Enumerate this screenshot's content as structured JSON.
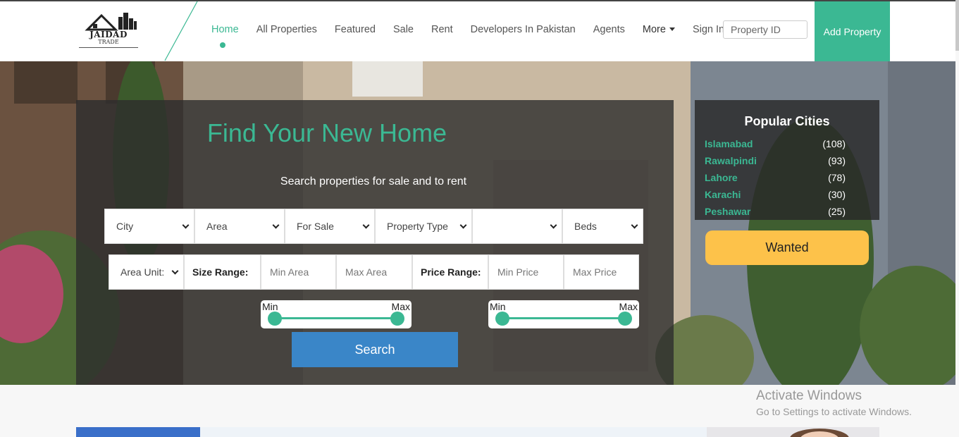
{
  "header": {
    "logo": {
      "line1": "JAIDAD",
      "line2": "TRADE"
    },
    "nav": [
      {
        "label": "Home",
        "active": true
      },
      {
        "label": "All Properties"
      },
      {
        "label": "Featured"
      },
      {
        "label": "Sale"
      },
      {
        "label": "Rent"
      },
      {
        "label": "Developers In Pakistan"
      },
      {
        "label": "Agents"
      },
      {
        "label": "More"
      },
      {
        "label": "Sign In"
      }
    ],
    "property_id_placeholder": "Property ID",
    "add_property_label": "Add Property"
  },
  "search": {
    "title": "Find Your New Home",
    "subtitle": "Search properties for sale and to rent",
    "selects": [
      "City",
      "Area",
      "For Sale",
      "Property Type",
      "",
      "Beds"
    ],
    "area_unit": "Area Unit:",
    "size_range_label": "Size Range:",
    "min_area_placeholder": "Min Area",
    "max_area_placeholder": "Max Area",
    "price_range_label": "Price Range:",
    "min_price_placeholder": "Min Price",
    "max_price_placeholder": "Max Price",
    "slider_min_label": "Min",
    "slider_max_label": "Max",
    "search_label": "Search"
  },
  "popular_cities": {
    "title": "Popular Cities",
    "items": [
      {
        "name": "Islamabad",
        "count": "(108)"
      },
      {
        "name": "Rawalpindi",
        "count": "(93)"
      },
      {
        "name": "Lahore",
        "count": "(78)"
      },
      {
        "name": "Karachi",
        "count": "(30)"
      },
      {
        "name": "Peshawar",
        "count": "(25)"
      }
    ]
  },
  "wanted_label": "Wanted",
  "watermark": {
    "line1": "Activate Windows",
    "line2": "Go to Settings to activate Windows."
  },
  "colors": {
    "accent": "#3bb893",
    "button_blue": "#3a86c8",
    "wanted": "#fdc24a"
  }
}
